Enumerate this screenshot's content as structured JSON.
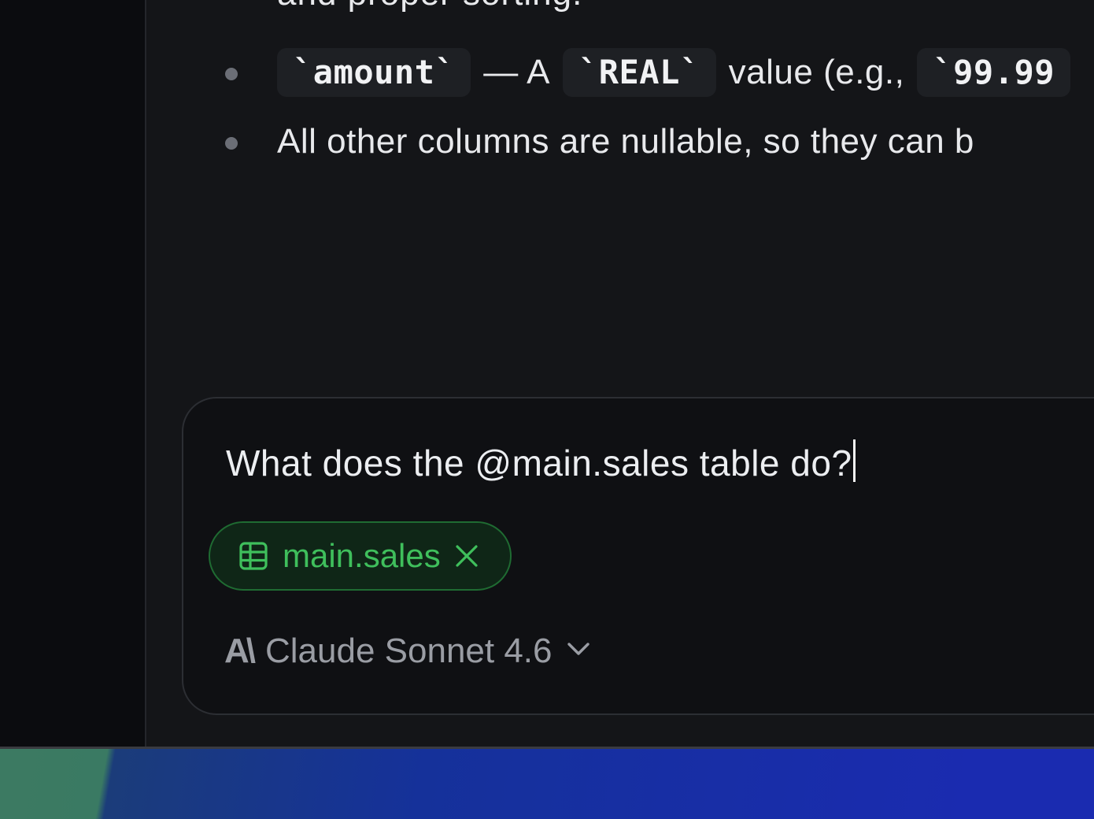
{
  "message": {
    "cut_line": "and proper sorting.",
    "bullets": [
      {
        "code1": "`amount`",
        "text1": "— A",
        "code2": "`REAL`",
        "text2": "value (e.g.,",
        "code3": "`99.99"
      },
      {
        "text": "All other columns are nullable, so they can b"
      }
    ]
  },
  "composer": {
    "input_value": "What does the @main.sales table do?",
    "chip": {
      "label": "main.sales",
      "icon": "table-icon",
      "remove_icon": "close-icon",
      "color": "#3fbf5c"
    },
    "model": {
      "logo": "A\\",
      "label": "Claude Sonnet 4.6",
      "dropdown_icon": "chevron-down-icon"
    }
  },
  "colors": {
    "background": "#141518",
    "sidebar": "#0b0c0f",
    "accent_green": "#3fbf5c"
  }
}
